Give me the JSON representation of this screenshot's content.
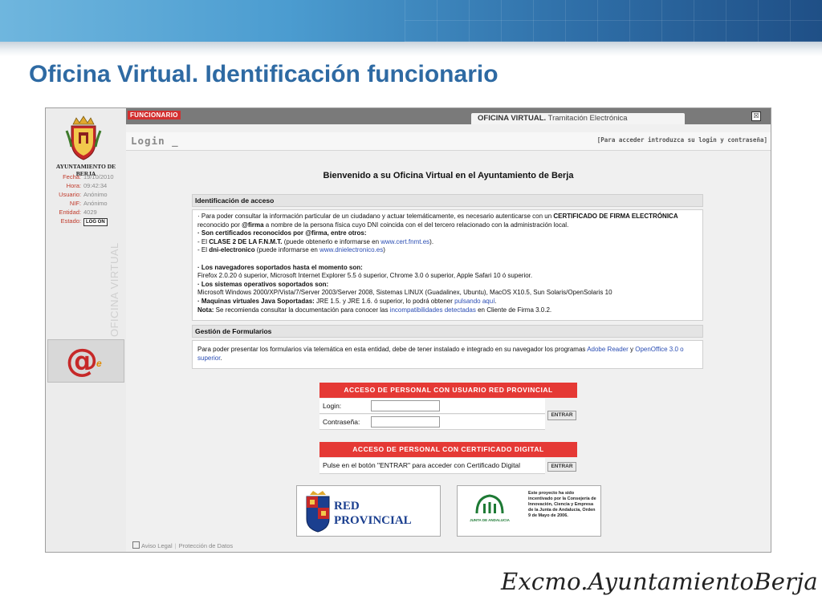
{
  "slide": {
    "title": "Oficina Virtual. Identificación funcionario",
    "signature": "Excmo.AyuntamientoBerja"
  },
  "sidebar": {
    "city_name": "AYUNTAMIENTO DE BERJA",
    "info": [
      {
        "key": "Fecha:",
        "value": "19/10/2010"
      },
      {
        "key": "Hora:",
        "value": "09:42:34"
      },
      {
        "key": "Usuario:",
        "value": "Anónimo"
      },
      {
        "key": "NIF:",
        "value": "Anónimo"
      },
      {
        "key": "Entidad:",
        "value": "4029"
      }
    ],
    "estado_label": "Estado:",
    "logout_label": "LOG ON",
    "vertical_label": "OFICINA VIRTUAL"
  },
  "header": {
    "badge": "FUNCIONARIO",
    "tab_bold": "OFICINA VIRTUAL.",
    "tab_rest": " Tramitación Electrónica",
    "close_icon": "☒",
    "login_title": "Login _",
    "login_hint": "[Para acceder introduzca su login y contraseña]"
  },
  "welcome": "Bienvenido a su Oficina Virtual en el Ayuntamiento de Berja",
  "identificacion": {
    "title": "Identificación de acceso",
    "p1_a": "· Para poder consultar la información particular de un ciudadano y actuar telemáticamente, es necesario autenticarse con un ",
    "p1_b": "CERTIFICADO DE FIRMA ELECTRÓNICA",
    "p1_c": " reconocido por ",
    "p1_d": "@firma",
    "p1_e": " a nombre de la persona física cuyo DNI coincida con el del tercero relacionado con la administración local.",
    "p2": "· Son certificados reconocidos por @firma, entre otros:",
    "p3_a": "- El ",
    "p3_b": "CLASE 2 DE LA F.N.M.T.",
    "p3_c": " (puede obtenerlo e informarse en ",
    "p3_link": "www.cert.fnmt.es",
    "p3_d": ").",
    "p4_a": "- El ",
    "p4_b": "dni-electronico",
    "p4_c": " (puede informarse en ",
    "p4_link": "www.dnielectronico.es",
    "p4_d": ")",
    "p5": "· Los navegadores soportados hasta el momento son:",
    "p6": "Firefox 2.0.20 ó superior, Microsoft Internet Explorer 5.5 ó superior, Chrome 3.0 ó superior, Apple Safari 10 ó superior.",
    "p7": "· Los sistemas operativos soportados son:",
    "p8": "Microsoft Windows 2000/XP/Vista/7/Server 2003/Server 2008, Sistemas LINUX (Guadalinex, Ubuntu), MacOS X10.5, Sun Solaris/OpenSolaris 10",
    "p9_a": "· Maquinas virtuales Java Soportadas:",
    "p9_b": " JRE 1.5. y JRE 1.6. ó superior, lo podrá obtener ",
    "p9_link": "pulsando aquí",
    "p9_c": ".",
    "p10_a": "Nota:",
    "p10_b": " Se recomienda consultar la documentación para conocer las ",
    "p10_link": "incompatibilidades detectadas",
    "p10_c": " en Cliente de Firma 3.0.2."
  },
  "formularios": {
    "title": "Gestión de Formularios",
    "text_a": "Para poder presentar los formularios vía telemática en esta entidad, debe de tener instalado e integrado en su navegador los programas ",
    "link1": "Adobe Reader",
    "text_b": " y ",
    "link2": "OpenOffice 3.0 o superior",
    "text_c": "."
  },
  "acceso_usuario": {
    "title": "ACCESO DE PERSONAL CON USUARIO RED PROVINCIAL",
    "login_label": "Login:",
    "login_value": "",
    "password_label": "Contraseña:",
    "password_value": "",
    "submit": "ENTRAR"
  },
  "acceso_certificado": {
    "title": "ACCESO DE PERSONAL CON CERTIFICADO DIGITAL",
    "text": "Pulse en el botón \"ENTRAR\" para acceder con Certificado Digital",
    "submit": "ENTRAR"
  },
  "logos": {
    "red_line1": "RED",
    "red_line2": "PROVINCIAL",
    "junta_label": "JUNTA DE ANDALUCIA",
    "junta_text": "Este proyecto ha sido incentivado por la Consejería de Innovación, Ciencia y Empresa de la Junta de Andalucía, Orden 9 de Mayo de 2006."
  },
  "footer": {
    "aviso": "Aviso Legal",
    "proteccion": "Protección de Datos"
  },
  "colors": {
    "accent_red": "#e53935",
    "title_blue": "#2e6aa3",
    "link_blue": "#2a4db3"
  }
}
